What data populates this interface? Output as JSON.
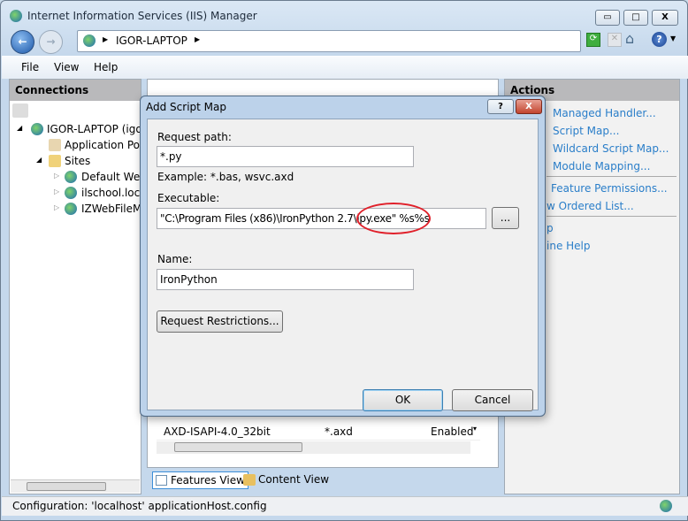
{
  "window": {
    "title": "Internet Information Services (IIS) Manager",
    "minimize": "▭",
    "maximize": "□",
    "close": "X"
  },
  "address": {
    "crumb": "IGOR-LAPTOP"
  },
  "menu": [
    "File",
    "View",
    "Help"
  ],
  "connections": {
    "header": "Connections",
    "tree": [
      "IGOR-LAPTOP (igor",
      "Application Poo",
      "Sites",
      "Default Web",
      "ilschool.loca",
      "IZWebFileMa"
    ]
  },
  "actions": {
    "header": "Actions",
    "items": [
      "Managed Handler...",
      "Script Map...",
      "Wildcard Script Map...",
      "Module Mapping...",
      "Feature Permissions...",
      "w Ordered List...",
      "p",
      "ine Help"
    ]
  },
  "grid": {
    "row": {
      "name": "AXD-ISAPI-4.0_32bit",
      "path": "*.axd",
      "state": "Enabled"
    }
  },
  "views": {
    "features": "Features View",
    "content": "Content View"
  },
  "status": "Configuration: 'localhost' applicationHost.config",
  "dialog": {
    "title": "Add Script Map",
    "help": "?",
    "close": "X",
    "request_path_label": "Request path:",
    "request_path": "*.py",
    "example": "Example: *.bas, wsvc.axd",
    "executable_label": "Executable:",
    "executable": "\"C:\\Program Files (x86)\\IronPython 2.7\\ipy.exe\" %s%s",
    "browse": "...",
    "name_label": "Name:",
    "name": "IronPython",
    "restrictions": "Request Restrictions...",
    "ok": "OK",
    "cancel": "Cancel"
  },
  "colors": {
    "link": "#2a7ec9",
    "highlight": "#e0202a"
  }
}
